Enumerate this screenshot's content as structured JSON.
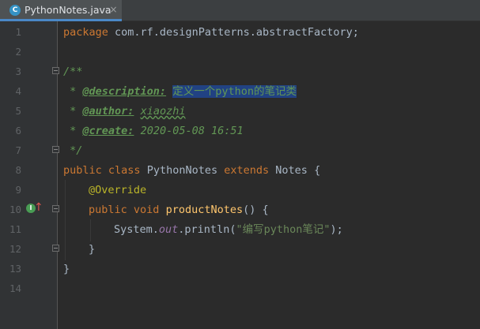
{
  "tab": {
    "icon_letter": "C",
    "label": "PythonNotes.java",
    "close_glyph": "×"
  },
  "gutter": {
    "line_numbers": [
      "1",
      "2",
      "3",
      "4",
      "5",
      "6",
      "7",
      "8",
      "9",
      "10",
      "11",
      "12",
      "13",
      "14"
    ],
    "impl_icon_letter": "I",
    "impl_arrow": "↑"
  },
  "code": {
    "l1": {
      "kw": "package",
      "rest": " com.rf.designPatterns.abstractFactory;"
    },
    "l3": {
      "text": "/**"
    },
    "l4": {
      "star": " * ",
      "tag": "@description:",
      "space": " ",
      "value": "定义一个python的笔记类"
    },
    "l5": {
      "star": " * ",
      "tag": "@author:",
      "space": " ",
      "value": "xiaozhi"
    },
    "l6": {
      "star": " * ",
      "tag": "@create:",
      "space": " ",
      "value": "2020-05-08 16:51"
    },
    "l7": {
      "text": " */"
    },
    "l8": {
      "kw1": "public",
      "kw2": "class",
      "name": "PythonNotes",
      "kw3": "extends",
      "parent": "Notes",
      "brace": "{"
    },
    "l9": {
      "annotation": "@Override"
    },
    "l10": {
      "kw1": "public",
      "kw2": "void",
      "method": "productNotes",
      "rest": "() {"
    },
    "l11": {
      "obj": "System.",
      "field": "out",
      "call": ".println(",
      "str": "\"编写python笔记\"",
      "end": ");"
    },
    "l12": {
      "text": "}"
    },
    "l13": {
      "text": "}"
    }
  }
}
